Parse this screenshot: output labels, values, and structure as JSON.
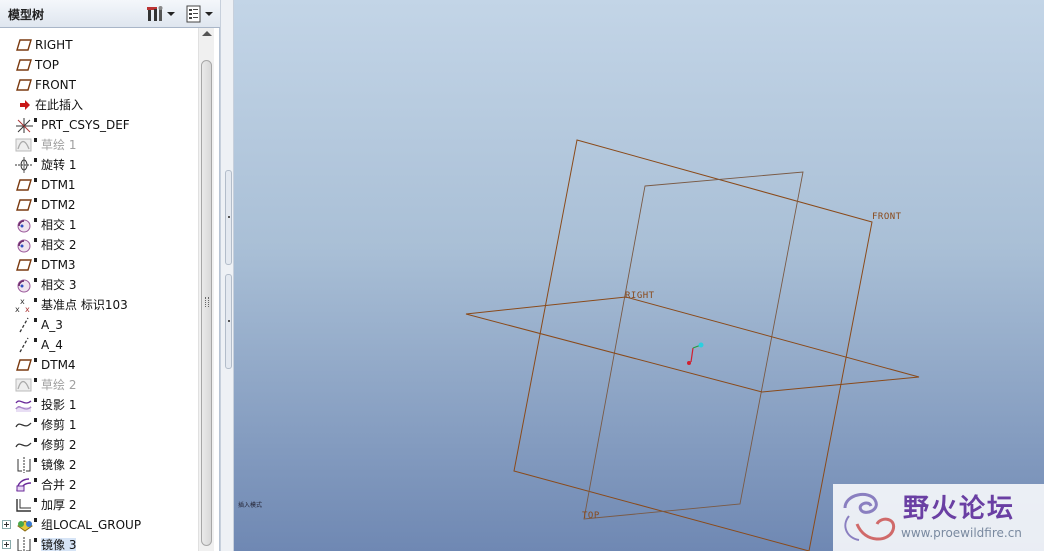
{
  "panel": {
    "title": "模型树"
  },
  "tree_items": [
    {
      "label": "RIGHT",
      "icon": "datum-plane-icon",
      "grayed": false
    },
    {
      "label": "TOP",
      "icon": "datum-plane-icon",
      "grayed": false
    },
    {
      "label": "FRONT",
      "icon": "datum-plane-icon",
      "grayed": false
    },
    {
      "label": "在此插入",
      "icon": "insert-here-arrow-icon",
      "grayed": false
    },
    {
      "label": "PRT_CSYS_DEF",
      "icon": "coordinate-system-icon",
      "grayed": false
    },
    {
      "label": "草绘 1",
      "icon": "sketch-icon",
      "grayed": true
    },
    {
      "label": "旋转 1",
      "icon": "revolve-icon",
      "grayed": false
    },
    {
      "label": "DTM1",
      "icon": "datum-plane-icon",
      "grayed": false
    },
    {
      "label": "DTM2",
      "icon": "datum-plane-icon",
      "grayed": false
    },
    {
      "label": "相交 1",
      "icon": "intersect-icon",
      "grayed": false
    },
    {
      "label": "相交 2",
      "icon": "intersect-icon",
      "grayed": false
    },
    {
      "label": "DTM3",
      "icon": "datum-plane-icon",
      "grayed": false
    },
    {
      "label": "相交 3",
      "icon": "intersect-icon",
      "grayed": false
    },
    {
      "label": "基准点 标识103",
      "icon": "datum-point-icon",
      "grayed": false
    },
    {
      "label": "A_3",
      "icon": "datum-axis-icon",
      "grayed": false
    },
    {
      "label": "A_4",
      "icon": "datum-axis-icon",
      "grayed": false
    },
    {
      "label": "DTM4",
      "icon": "datum-plane-icon",
      "grayed": false
    },
    {
      "label": "草绘 2",
      "icon": "sketch-icon",
      "grayed": true
    },
    {
      "label": "投影 1",
      "icon": "projection-icon",
      "grayed": false
    },
    {
      "label": "修剪 1",
      "icon": "trim-icon",
      "grayed": false
    },
    {
      "label": "修剪 2",
      "icon": "trim-icon",
      "grayed": false
    },
    {
      "label": "镜像 2",
      "icon": "mirror-icon",
      "grayed": false
    },
    {
      "label": "合并 2",
      "icon": "merge-icon",
      "grayed": false
    },
    {
      "label": "加厚 2",
      "icon": "thicken-icon",
      "grayed": false
    },
    {
      "label": "组LOCAL_GROUP",
      "icon": "group-icon",
      "grayed": false
    },
    {
      "label": "镜像 3",
      "icon": "mirror-icon",
      "grayed": false
    }
  ],
  "viewport": {
    "plane_labels": {
      "front": "FRONT",
      "right": "RIGHT",
      "top": "TOP"
    },
    "status_text": "插入模式"
  },
  "watermark": {
    "name": "野火论坛",
    "url": "www.proewildfire.cn"
  },
  "colors": {
    "plane_edge": "#8a4a1a",
    "bg_top": "#c3d5e7",
    "bg_bottom": "#6f88b3"
  }
}
